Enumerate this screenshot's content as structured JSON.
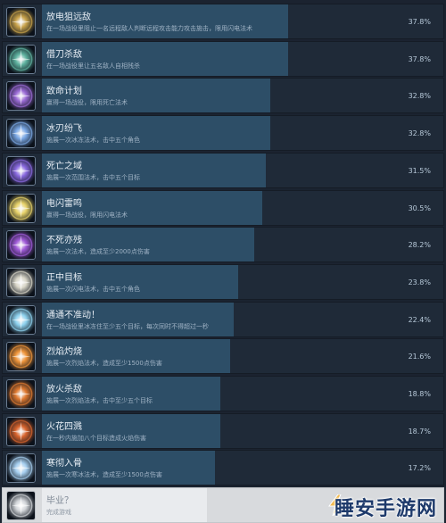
{
  "achievements": [
    {
      "title": "放电狙远敌",
      "desc": "在一场战役里阻止一名远程敌人判断远程攻击能力攻击施击，限用闪电法术",
      "percent": "37.8%",
      "fill": 37.8,
      "icon": "lightning-scroll-icon",
      "hue": "#c8a24a"
    },
    {
      "title": "借刀杀敌",
      "desc": "在一场战役里让五名敌人自相残杀",
      "percent": "37.8%",
      "fill": 37.8,
      "icon": "swirl-spirit-icon",
      "hue": "#5fb3a0"
    },
    {
      "title": "致命计划",
      "desc": "赢得一场战役，限用死亡法术",
      "percent": "32.8%",
      "fill": 32.8,
      "icon": "death-plan-icon",
      "hue": "#9b6bd6"
    },
    {
      "title": "冰刃纷飞",
      "desc": "施展一次冰冻法术，击中五个角色",
      "percent": "32.8%",
      "fill": 32.8,
      "icon": "ice-blades-icon",
      "hue": "#7aa8e6"
    },
    {
      "title": "死亡之域",
      "desc": "施展一次范围法术，击中五个目标",
      "percent": "31.5%",
      "fill": 31.5,
      "icon": "death-domain-icon",
      "hue": "#8a6ae0"
    },
    {
      "title": "电闪雷鸣",
      "desc": "赢得一场战役，限用闪电法术",
      "percent": "30.5%",
      "fill": 30.5,
      "icon": "thunder-burst-icon",
      "hue": "#e8d36a"
    },
    {
      "title": "不死亦残",
      "desc": "施展一次法术，造成至少2000点伤害",
      "percent": "28.2%",
      "fill": 28.2,
      "icon": "purple-blast-icon",
      "hue": "#a05ad8"
    },
    {
      "title": "正中目标",
      "desc": "施展一次闪电法术，击中五个角色",
      "percent": "23.8%",
      "fill": 23.8,
      "icon": "lightning-target-icon",
      "hue": "#d9d6c8"
    },
    {
      "title": "通通不准动！",
      "desc": "在一场战役里冰冻住至少五个目标，每次同时不得超过一秒",
      "percent": "22.4%",
      "fill": 22.4,
      "icon": "frost-star-icon",
      "hue": "#8fd3ef"
    },
    {
      "title": "烈焰灼烧",
      "desc": "施展一次烈焰法术，造成至少1500点伤害",
      "percent": "21.6%",
      "fill": 21.6,
      "icon": "flame-icon",
      "hue": "#f0953a"
    },
    {
      "title": "放火杀敌",
      "desc": "施展一次烈焰法术，击中至少五个目标",
      "percent": "18.8%",
      "fill": 18.8,
      "icon": "fire-burst-icon",
      "hue": "#e07a30"
    },
    {
      "title": "火花四溅",
      "desc": "在一秒内施加八个目标造成火焰伤害",
      "percent": "18.7%",
      "fill": 18.7,
      "icon": "fire-sparks-icon",
      "hue": "#d9652e"
    },
    {
      "title": "寒彻入骨",
      "desc": "施展一次寒冰法术，造成至少1500点伤害",
      "percent": "17.2%",
      "fill": 17.2,
      "icon": "frost-burst-icon",
      "hue": "#a6cff0"
    },
    {
      "title": "毕业？",
      "desc": "完成游戏",
      "percent": "",
      "fill": 15.0,
      "icon": "graduation-icon",
      "hue": "#d3d6da",
      "completed": true
    }
  ],
  "watermark": {
    "text": "睡安手游网",
    "icon": "lightning-bolt-icon"
  },
  "colors": {
    "bar": "#2d4e67",
    "row": "#1f2a38",
    "background": "#1b2330"
  }
}
